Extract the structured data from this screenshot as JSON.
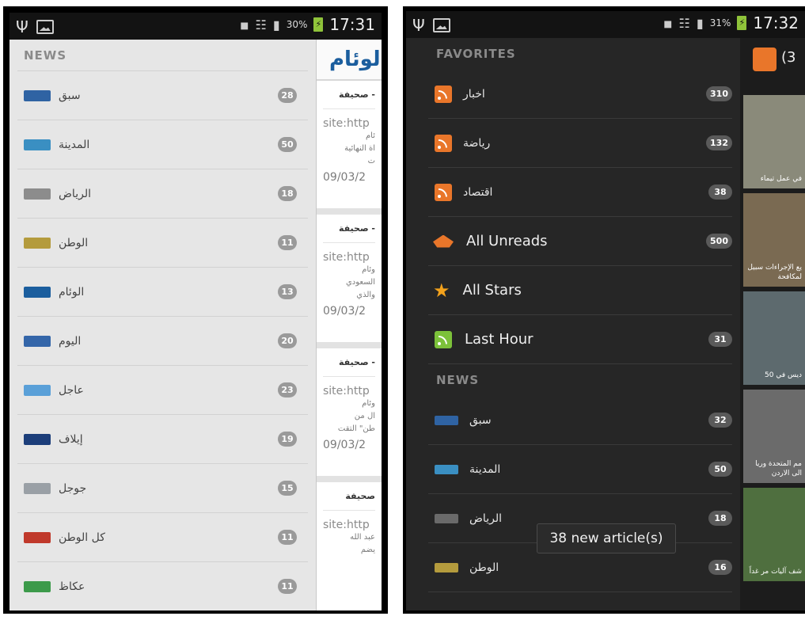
{
  "left_phone": {
    "status": {
      "battery": "30%",
      "time": "17:31"
    },
    "drawer": {
      "section": "NEWS",
      "items": [
        {
          "name": "سبق",
          "count": "28",
          "logo_color": "#2f63a3"
        },
        {
          "name": "المدينة",
          "count": "50",
          "logo_color": "#3a8fc2"
        },
        {
          "name": "الرياض",
          "count": "18",
          "logo_color": "#8c8c8c"
        },
        {
          "name": "الوطن",
          "count": "11",
          "logo_color": "#b49b3d"
        },
        {
          "name": "الوئام",
          "count": "13",
          "logo_color": "#1b5e9e"
        },
        {
          "name": "اليوم",
          "count": "20",
          "logo_color": "#3466a9"
        },
        {
          "name": "عاجل",
          "count": "23",
          "logo_color": "#5aa0d8"
        },
        {
          "name": "إيلاف",
          "count": "19",
          "logo_color": "#1c3e7a"
        },
        {
          "name": "جوجل",
          "count": "15",
          "logo_color": "#9aa0a6"
        },
        {
          "name": "كل الوطن",
          "count": "11",
          "logo_color": "#c0392b"
        },
        {
          "name": "عكاظ",
          "count": "11",
          "logo_color": "#3c9a4a"
        }
      ]
    },
    "content": {
      "logo": "الوئام",
      "articles": [
        {
          "title": "صحيفة -",
          "site": "site:http",
          "excerpt": [
            "ئام",
            "اة النهائية",
            "ت"
          ],
          "date": "09/03/2"
        },
        {
          "title": "صحيفة -",
          "site": "site:http",
          "excerpt": [
            "وئام",
            "السعودي",
            "والذي"
          ],
          "date": "09/03/2"
        },
        {
          "title": "صحيفة -",
          "site": "site:http",
          "excerpt": [
            "وئام",
            "ال من",
            "طن\" التقت"
          ],
          "date": "09/03/2"
        },
        {
          "title": "صحيفة",
          "site": "site:http",
          "excerpt": [
            "",
            "عبد الله",
            "يضم"
          ],
          "date": ""
        }
      ]
    }
  },
  "right_phone": {
    "status": {
      "battery": "31%",
      "time": "17:32"
    },
    "drawer": {
      "favorites_header": "FAVORITES",
      "favorites": [
        {
          "name": "اخبار",
          "count": "310",
          "icon": "rss-icon"
        },
        {
          "name": "رياضة",
          "count": "132",
          "icon": "rss-icon"
        },
        {
          "name": "اقتصاد",
          "count": "38",
          "icon": "rss-icon"
        }
      ],
      "specials": [
        {
          "name": "All Unreads",
          "count": "500",
          "icon": "unread-icon"
        },
        {
          "name": "All Stars",
          "count": "",
          "icon": "star-icon"
        },
        {
          "name": "Last Hour",
          "count": "31",
          "icon": "rss-icon"
        }
      ],
      "news_header": "NEWS",
      "news": [
        {
          "name": "سبق",
          "count": "32",
          "logo_color": "#2f63a3"
        },
        {
          "name": "المدينة",
          "count": "50",
          "logo_color": "#3a8fc2"
        },
        {
          "name": "الرياض",
          "count": "18",
          "logo_color": "#6a6a6a"
        },
        {
          "name": "الوطن",
          "count": "16",
          "logo_color": "#b49b3d"
        }
      ]
    },
    "toast": "38 new article(s)",
    "content": {
      "count": "(3",
      "tiles": [
        "في عمل تيماء",
        "يع الإجراءات سبيل لمكافحة",
        "ديس في 50",
        "مم المتحدة وريا الى الاردن",
        "شف آليات مر غداً"
      ]
    }
  }
}
